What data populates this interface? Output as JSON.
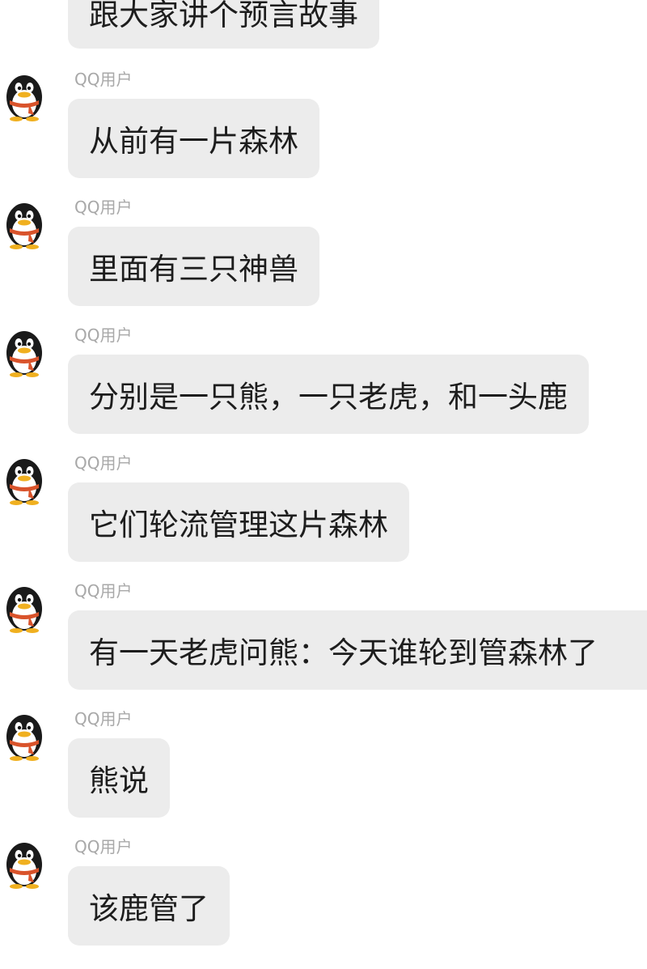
{
  "top_message": "跟大家讲个预言故事",
  "sender_name": "QQ用户",
  "messages": [
    {
      "sender": "QQ用户",
      "text": "从前有一片森林"
    },
    {
      "sender": "QQ用户",
      "text": "里面有三只神兽"
    },
    {
      "sender": "QQ用户",
      "text": "分别是一只熊，一只老虎，和一头鹿"
    },
    {
      "sender": "QQ用户",
      "text": "它们轮流管理这片森林"
    },
    {
      "sender": "QQ用户",
      "text": "有一天老虎问熊：今天谁轮到管森林了"
    },
    {
      "sender": "QQ用户",
      "text": "熊说"
    },
    {
      "sender": "QQ用户",
      "text": "该鹿管了"
    }
  ],
  "avatar_icon": "qq-penguin-icon",
  "colors": {
    "bubble": "#ececec",
    "sender_text": "#a8a8a8",
    "message_text": "#1d1d1d",
    "scarf": "#d9532b"
  }
}
